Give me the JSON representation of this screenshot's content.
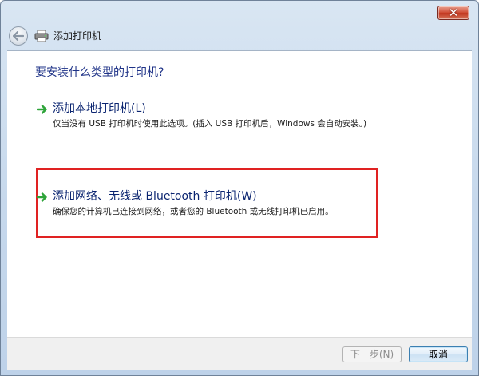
{
  "window": {
    "close_glyph": "✕"
  },
  "nav": {
    "back_icon": "back-arrow-icon",
    "app_icon": "printer-icon",
    "title": "添加打印机"
  },
  "main": {
    "question": "要安装什么类型的打印机?",
    "options": [
      {
        "icon": "green-arrow-icon",
        "title": "添加本地打印机(L)",
        "description": "仅当没有 USB 打印机时使用此选项。(插入 USB 打印机后，Windows 会自动安装。)"
      },
      {
        "icon": "green-arrow-icon",
        "title": "添加网络、无线或 Bluetooth 打印机(W)",
        "description": "确保您的计算机已连接到网络，或者您的 Bluetooth 或无线打印机已启用。"
      }
    ]
  },
  "footer": {
    "next_label": "下一步(N)",
    "cancel_label": "取消"
  },
  "colors": {
    "highlight_border": "#e02222",
    "heading_blue": "#1e3287",
    "arrow_green": "#2ea43a"
  }
}
